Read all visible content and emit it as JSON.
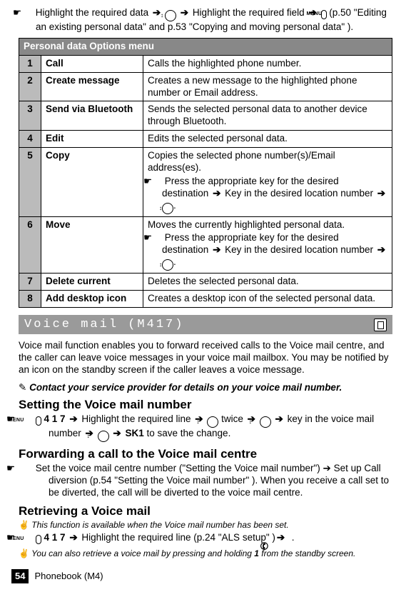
{
  "intro": {
    "pre": "Highlight the required data",
    "mid": "Highlight the required field",
    "tail": "(p.50 \"Editing an existing personal data\"  and p.53 \"Copying and moving personal data\" )."
  },
  "table": {
    "header": "Personal data Options menu",
    "rows": [
      {
        "n": "1",
        "name": "Call",
        "desc": "Calls the highlighted phone number."
      },
      {
        "n": "2",
        "name": "Create message",
        "desc": "Creates a new message to the highlighted phone number or Email address."
      },
      {
        "n": "3",
        "name": "Send via Bluetooth",
        "desc": "Sends the selected personal data to another device through Bluetooth."
      },
      {
        "n": "4",
        "name": "Edit",
        "desc": "Edits the selected personal data."
      },
      {
        "n": "5",
        "name": "Copy",
        "desc": "Copies the selected phone number(s)/Email address(es).",
        "sub_pre": "Press the appropriate key for the desired destination",
        "sub_post": "Key in the desired location number",
        "sub_end": "."
      },
      {
        "n": "6",
        "name": "Move",
        "desc": "Moves the currently highlighted personal data.",
        "sub_pre": "Press the appropriate key for the desired destination",
        "sub_post": "Key in the desired location number",
        "sub_end": "."
      },
      {
        "n": "7",
        "name": "Delete current",
        "desc": "Deletes the selected personal data."
      },
      {
        "n": "8",
        "name": "Add desktop icon",
        "desc": "Creates a desktop icon of the selected personal data."
      }
    ]
  },
  "section_title": "Voice mail (M417)",
  "vm_paragraph": "Voice mail function enables you to forward received calls to the Voice mail centre, and the caller can leave voice messages in your voice mail mailbox. You may be notified by an icon on the standby screen if the caller leaves a voice message.",
  "vm_note": "Contact your service provider for details on your voice mail number.",
  "set_heading": "Setting the Voice mail number",
  "set_step": {
    "nums": " 4 1 7 ",
    "a": "Highlight the required line",
    "twice": "twice",
    "b": "key in the voice mail number",
    "sk1": "SK1",
    "c": " to save the change."
  },
  "fwd_heading": "Forwarding a call to the Voice mail centre",
  "fwd_step": "Set the voice mail centre number (\"Setting the Voice mail number\") ➔ Set up Call diversion (p.54 \"Setting the Voice mail number\" ). When you receive a call set to be diverted, the call will be diverted to the voice mail centre.",
  "ret_heading": "Retrieving a Voice mail",
  "ret_note1": "This function is available when the Voice mail number has been set.",
  "ret_step": {
    "nums": " 4 1 7 ",
    "a": "Highlight the required line (p.24 \"ALS setup\" )"
  },
  "ret_note2_pre": "You can also retrieve a voice mail by pressing and holding ",
  "ret_note2_bold": "1",
  "ret_note2_post": " from the standby screen.",
  "footer": {
    "page": "54",
    "section": "Phonebook (M4)"
  },
  "glyph": {
    "hand": "☛",
    "memo": "✎",
    "victory": "✌",
    "arrow": "➔",
    "nav": "↕",
    "menu": "MENU",
    "call": "✆"
  }
}
